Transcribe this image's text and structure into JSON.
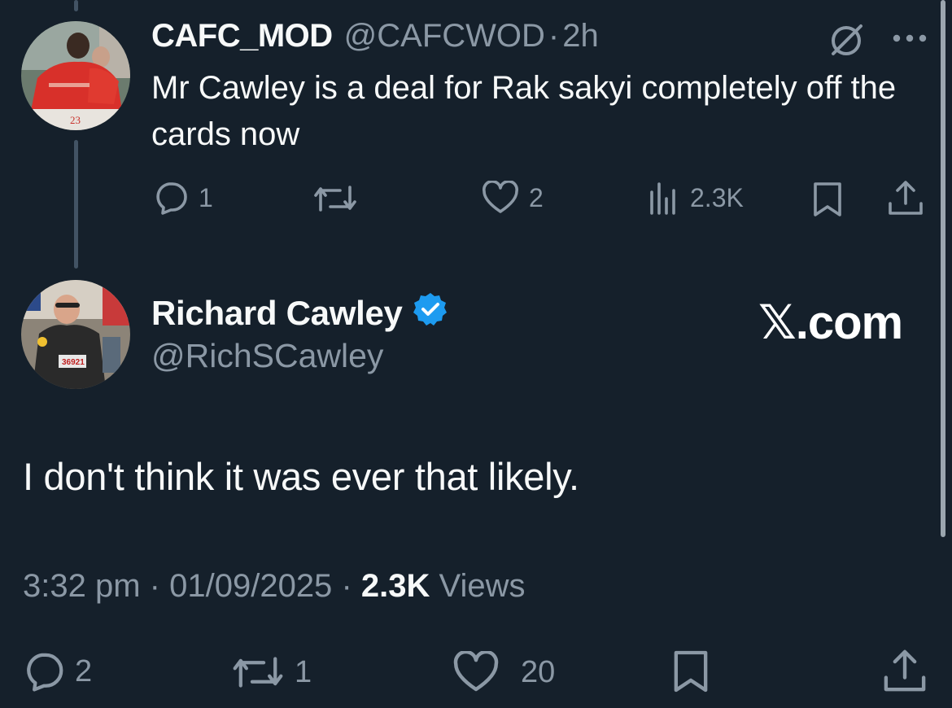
{
  "parent_tweet": {
    "display_name": "CAFC_MOD",
    "handle": "@CAFCWOD",
    "separator": "·",
    "time": "2h",
    "text": "Mr Cawley is a deal for Rak sakyi completely off the cards now",
    "avatar_number": "23",
    "actions": {
      "replies": "1",
      "reposts": "",
      "likes": "2",
      "views": "2.3K"
    }
  },
  "main_tweet": {
    "display_name": "Richard Cawley",
    "handle": "@RichSCawley",
    "watermark": "𝕏.com",
    "text": "I don't think it was ever that likely.",
    "avatar_bib": "36921",
    "time": "3:32 pm",
    "date": "01/09/2025",
    "separator": "·",
    "views_count": "2.3K",
    "views_label": "Views",
    "actions": {
      "replies": "2",
      "reposts": "1",
      "likes": "20"
    }
  },
  "icons": {
    "reply": "reply-icon",
    "repost": "repost-icon",
    "like": "heart-icon",
    "views": "views-icon",
    "bookmark": "bookmark-icon",
    "share": "share-icon",
    "grok": "grok-icon",
    "more": "more-icon",
    "verified": "verified-badge-icon"
  },
  "colors": {
    "background": "#15202b",
    "text_primary": "#f7f9f9",
    "text_secondary": "#8b98a5",
    "verified": "#1d9bf0"
  }
}
